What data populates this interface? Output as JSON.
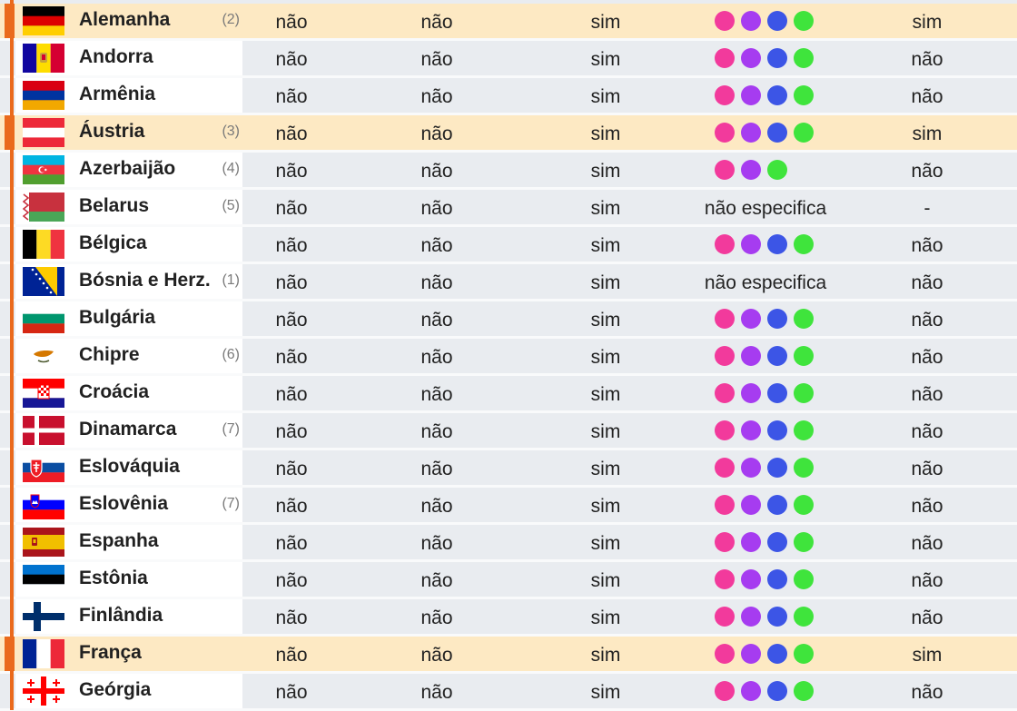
{
  "colors": {
    "pink": "#f23a9c",
    "purple": "#a63cf0",
    "blue": "#3c55e6",
    "green": "#3fe43c",
    "highlight_row": "#fde9c3",
    "accent_orange": "#ea6a1c"
  },
  "rows": [
    {
      "country": "Alemanha",
      "note": "(2)",
      "flag": "germany-flag",
      "highlight": true,
      "c1": "não",
      "c2": "não",
      "c3": "sim",
      "dots": [
        "pink",
        "purple",
        "blue",
        "green"
      ],
      "c5": "sim"
    },
    {
      "country": "Andorra",
      "note": "",
      "flag": "andorra-flag",
      "highlight": false,
      "c1": "não",
      "c2": "não",
      "c3": "sim",
      "dots": [
        "pink",
        "purple",
        "blue",
        "green"
      ],
      "c5": "não"
    },
    {
      "country": "Armênia",
      "note": "",
      "flag": "armenia-flag",
      "highlight": false,
      "c1": "não",
      "c2": "não",
      "c3": "sim",
      "dots": [
        "pink",
        "purple",
        "blue",
        "green"
      ],
      "c5": "não"
    },
    {
      "country": "Áustria",
      "note": "(3)",
      "flag": "austria-flag",
      "highlight": true,
      "c1": "não",
      "c2": "não",
      "c3": "sim",
      "dots": [
        "pink",
        "purple",
        "blue",
        "green"
      ],
      "c5": "sim"
    },
    {
      "country": "Azerbaijão",
      "note": "(4)",
      "flag": "azerbaijan-flag",
      "highlight": false,
      "c1": "não",
      "c2": "não",
      "c3": "sim",
      "dots": [
        "pink",
        "purple",
        "green"
      ],
      "c5": "não"
    },
    {
      "country": "Belarus",
      "note": "(5)",
      "flag": "belarus-flag",
      "highlight": false,
      "c1": "não",
      "c2": "não",
      "c3": "sim",
      "spec": "não especifica",
      "c5": "-"
    },
    {
      "country": "Bélgica",
      "note": "",
      "flag": "belgium-flag",
      "highlight": false,
      "c1": "não",
      "c2": "não",
      "c3": "sim",
      "dots": [
        "pink",
        "purple",
        "blue",
        "green"
      ],
      "c5": "não"
    },
    {
      "country": "Bósnia e Herz.",
      "note": "(1)",
      "flag": "bosnia-flag",
      "highlight": false,
      "c1": "não",
      "c2": "não",
      "c3": "sim",
      "spec": "não especifica",
      "c5": "não"
    },
    {
      "country": "Bulgária",
      "note": "",
      "flag": "bulgaria-flag",
      "highlight": false,
      "c1": "não",
      "c2": "não",
      "c3": "sim",
      "dots": [
        "pink",
        "purple",
        "blue",
        "green"
      ],
      "c5": "não"
    },
    {
      "country": "Chipre",
      "note": "(6)",
      "flag": "cyprus-flag",
      "highlight": false,
      "c1": "não",
      "c2": "não",
      "c3": "sim",
      "dots": [
        "pink",
        "purple",
        "blue",
        "green"
      ],
      "c5": "não"
    },
    {
      "country": "Croácia",
      "note": "",
      "flag": "croatia-flag",
      "highlight": false,
      "c1": "não",
      "c2": "não",
      "c3": "sim",
      "dots": [
        "pink",
        "purple",
        "blue",
        "green"
      ],
      "c5": "não"
    },
    {
      "country": "Dinamarca",
      "note": "(7)",
      "flag": "denmark-flag",
      "highlight": false,
      "c1": "não",
      "c2": "não",
      "c3": "sim",
      "dots": [
        "pink",
        "purple",
        "blue",
        "green"
      ],
      "c5": "não"
    },
    {
      "country": "Eslováquia",
      "note": "",
      "flag": "slovakia-flag",
      "highlight": false,
      "c1": "não",
      "c2": "não",
      "c3": "sim",
      "dots": [
        "pink",
        "purple",
        "blue",
        "green"
      ],
      "c5": "não"
    },
    {
      "country": "Eslovênia",
      "note": "(7)",
      "flag": "slovenia-flag",
      "highlight": false,
      "c1": "não",
      "c2": "não",
      "c3": "sim",
      "dots": [
        "pink",
        "purple",
        "blue",
        "green"
      ],
      "c5": "não"
    },
    {
      "country": "Espanha",
      "note": "",
      "flag": "spain-flag",
      "highlight": false,
      "c1": "não",
      "c2": "não",
      "c3": "sim",
      "dots": [
        "pink",
        "purple",
        "blue",
        "green"
      ],
      "c5": "não"
    },
    {
      "country": "Estônia",
      "note": "",
      "flag": "estonia-flag",
      "highlight": false,
      "c1": "não",
      "c2": "não",
      "c3": "sim",
      "dots": [
        "pink",
        "purple",
        "blue",
        "green"
      ],
      "c5": "não"
    },
    {
      "country": "Finlândia",
      "note": "",
      "flag": "finland-flag",
      "highlight": false,
      "c1": "não",
      "c2": "não",
      "c3": "sim",
      "dots": [
        "pink",
        "purple",
        "blue",
        "green"
      ],
      "c5": "não"
    },
    {
      "country": "França",
      "note": "",
      "flag": "france-flag",
      "highlight": true,
      "c1": "não",
      "c2": "não",
      "c3": "sim",
      "dots": [
        "pink",
        "purple",
        "blue",
        "green"
      ],
      "c5": "sim"
    },
    {
      "country": "Geórgia",
      "note": "",
      "flag": "georgia-flag",
      "highlight": false,
      "c1": "não",
      "c2": "não",
      "c3": "sim",
      "dots": [
        "pink",
        "purple",
        "blue",
        "green"
      ],
      "c5": "não"
    }
  ]
}
